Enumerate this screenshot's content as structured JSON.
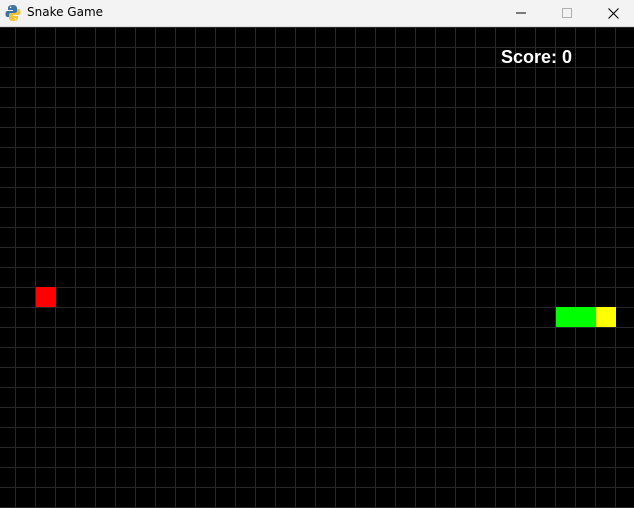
{
  "window": {
    "title": "Snake Game",
    "app_icon": "python-pygame-icon",
    "controls": [
      "minimize-icon",
      "maximize-icon",
      "close-icon"
    ]
  },
  "game": {
    "score_label": "Score: 0",
    "score": 0,
    "grid_columns": 32,
    "grid_rows": 24,
    "food": {
      "col": 1,
      "row": 13
    },
    "snake": [
      {
        "col": 29,
        "row": 14,
        "part": "head"
      },
      {
        "col": 28,
        "row": 14,
        "part": "body"
      },
      {
        "col": 27,
        "row": 14,
        "part": "body"
      }
    ]
  },
  "colors": {
    "background": "#000000",
    "grid_line": "#282828",
    "food": "#ff0000",
    "snake_body": "#00ff00",
    "snake_head": "#ffff00",
    "score_text": "#ffffff"
  }
}
